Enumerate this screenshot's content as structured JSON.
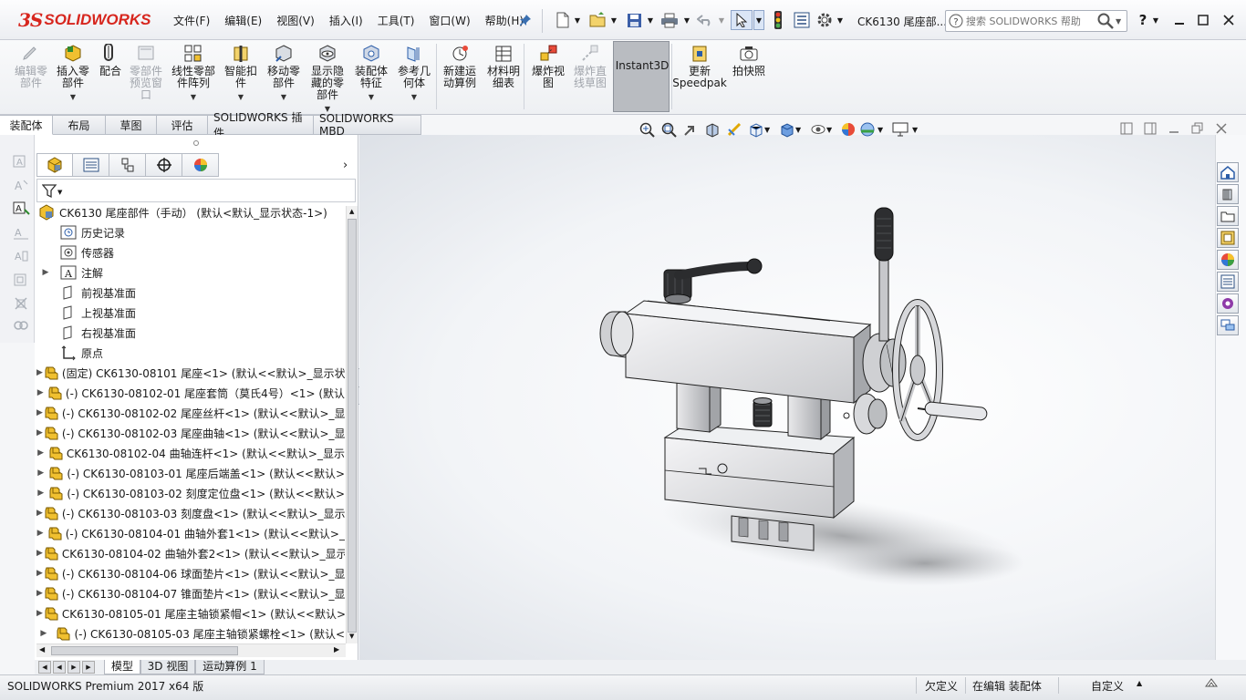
{
  "app": {
    "logo_prefix": "3S",
    "logo_text": "SOLIDWORKS",
    "doc_title": "CK6130 尾座部...",
    "search_placeholder": "搜索 SOLIDWORKS 帮助",
    "help_label": "?"
  },
  "menus": [
    "文件(F)",
    "编辑(E)",
    "视图(V)",
    "插入(I)",
    "工具(T)",
    "窗口(W)",
    "帮助(H)"
  ],
  "commands": [
    {
      "label": "编辑零\n部件",
      "disabled": true,
      "icon": "edit-component-icon"
    },
    {
      "label": "插入零\n部件",
      "disabled": false,
      "icon": "insert-components-icon"
    },
    {
      "label": "配合",
      "disabled": false,
      "icon": "mate-icon"
    },
    {
      "label": "零部件\n预览窗\n口",
      "disabled": true,
      "icon": "component-preview-icon"
    },
    {
      "label": "线性零部\n件阵列",
      "disabled": false,
      "icon": "linear-pattern-icon"
    },
    {
      "label": "智能扣\n件",
      "disabled": false,
      "icon": "smart-fasteners-icon"
    },
    {
      "label": "移动零\n部件",
      "disabled": false,
      "icon": "move-component-icon"
    },
    {
      "label": "显示隐\n藏的零\n部件",
      "disabled": false,
      "icon": "show-hidden-icon"
    },
    {
      "label": "装配体\n特征",
      "disabled": false,
      "icon": "assembly-features-icon"
    },
    {
      "label": "参考几\n何体",
      "disabled": false,
      "icon": "reference-geometry-icon"
    },
    {
      "label": "新建运\n动算例",
      "disabled": false,
      "icon": "motion-study-icon"
    },
    {
      "label": "材料明\n细表",
      "disabled": false,
      "icon": "bom-icon"
    },
    {
      "label": "爆炸视\n图",
      "disabled": false,
      "icon": "exploded-view-icon"
    },
    {
      "label": "爆炸直\n线草图",
      "disabled": true,
      "icon": "explode-line-icon"
    },
    {
      "label": "Instant3D",
      "disabled": false,
      "icon": "instant3d-icon"
    },
    {
      "label": "更新\nSpeedpak",
      "disabled": false,
      "icon": "speedpak-icon"
    },
    {
      "label": "拍快照",
      "disabled": false,
      "icon": "snapshot-icon"
    }
  ],
  "tabs": [
    "装配体",
    "布局",
    "草图",
    "评估",
    "SOLIDWORKS 插件",
    "SOLIDWORKS MBD"
  ],
  "tree": {
    "root": "CK6130 尾座部件（手动） (默认<默认_显示状态-1>)",
    "items": [
      {
        "label": "历史记录",
        "icon": "history-icon",
        "expand": false
      },
      {
        "label": "传感器",
        "icon": "sensor-icon",
        "expand": false
      },
      {
        "label": "注解",
        "icon": "annotation-icon",
        "expand": true
      },
      {
        "label": "前视基准面",
        "icon": "plane-icon",
        "expand": false
      },
      {
        "label": "上视基准面",
        "icon": "plane-icon",
        "expand": false
      },
      {
        "label": "右视基准面",
        "icon": "plane-icon",
        "expand": false
      },
      {
        "label": "原点",
        "icon": "origin-icon",
        "expand": false
      },
      {
        "label": "(固定) CK6130-08101 尾座<1> (默认<<默认>_显示状",
        "icon": "part-icon",
        "expand": true
      },
      {
        "label": "(-) CK6130-08102-01 尾座套筒（莫氏4号）<1> (默认",
        "icon": "part-icon",
        "expand": true
      },
      {
        "label": "(-) CK6130-08102-02 尾座丝杆<1> (默认<<默认>_显",
        "icon": "part-icon",
        "expand": true
      },
      {
        "label": "(-) CK6130-08102-03 尾座曲轴<1> (默认<<默认>_显",
        "icon": "part-icon",
        "expand": true
      },
      {
        "label": "CK6130-08102-04 曲轴连杆<1> (默认<<默认>_显示",
        "icon": "part-icon",
        "expand": true
      },
      {
        "label": "(-) CK6130-08103-01 尾座后端盖<1> (默认<<默认>",
        "icon": "part-icon",
        "expand": true
      },
      {
        "label": "(-) CK6130-08103-02 刻度定位盘<1> (默认<<默认>",
        "icon": "part-icon",
        "expand": true
      },
      {
        "label": "(-) CK6130-08103-03 刻度盘<1> (默认<<默认>_显示",
        "icon": "part-icon",
        "expand": true
      },
      {
        "label": "(-) CK6130-08104-01 曲轴外套1<1> (默认<<默认>_",
        "icon": "part-icon",
        "expand": true
      },
      {
        "label": "CK6130-08104-02 曲轴外套2<1> (默认<<默认>_显示",
        "icon": "part-icon",
        "expand": true
      },
      {
        "label": "(-) CK6130-08104-06 球面垫片<1> (默认<<默认>_显",
        "icon": "part-icon",
        "expand": true
      },
      {
        "label": "(-) CK6130-08104-07 锥面垫片<1> (默认<<默认>_显",
        "icon": "part-icon",
        "expand": true
      },
      {
        "label": "CK6130-08105-01 尾座主轴锁紧帽<1> (默认<<默认>",
        "icon": "part-icon",
        "expand": true
      },
      {
        "label": "(-) CK6130-08105-03 尾座主轴锁紧螺栓<1> (默认<",
        "icon": "part-icon",
        "expand": true
      }
    ]
  },
  "bottom_tabs": [
    "模型",
    "3D 视图",
    "运动算例 1"
  ],
  "status": {
    "product": "SOLIDWORKS Premium 2017 x64 版",
    "state1": "欠定义",
    "state2": "在编辑 装配体",
    "units": "自定义"
  },
  "colors": {
    "brand": "#d7261e",
    "active_command_bg": "#b9bcc1",
    "viewport_bg": "#ffffff"
  }
}
